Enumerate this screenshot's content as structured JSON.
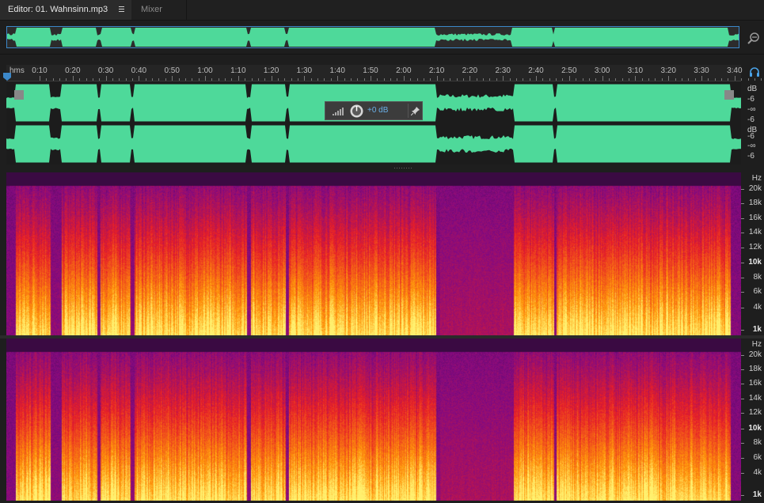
{
  "tabs": {
    "editor_label": "Editor: 01. Wahnsinn.mp3",
    "mixer_label": "Mixer"
  },
  "icons": [
    "panel-menu-icon",
    "zoom-icon",
    "playhead-icon",
    "headphone-icon",
    "hud-meter-icon",
    "gain-knob-icon",
    "pin-icon",
    "scroll-handle-icon"
  ],
  "colors": {
    "waveform": "#4ed99a",
    "selection_border": "#3c88c9",
    "accent_blue": "#6ab0e8",
    "background": "#1e1e1e"
  },
  "ruler": {
    "unit": "hms",
    "ticks": [
      "0:10",
      "0:20",
      "0:30",
      "0:40",
      "0:50",
      "1:00",
      "1:10",
      "1:20",
      "1:30",
      "1:40",
      "1:50",
      "2:00",
      "2:10",
      "2:20",
      "2:30",
      "2:40",
      "2:50",
      "3:00",
      "3:10",
      "3:20",
      "3:30",
      "3:40"
    ]
  },
  "amplitude_scale": {
    "ch1": [
      "dB",
      "-6",
      "-∞",
      "-6"
    ],
    "ch2": [
      "dB",
      "-6",
      "-∞",
      "-6"
    ]
  },
  "hud": {
    "gain": "+0 dB"
  },
  "frequency_scale": {
    "unit": "Hz",
    "labels": [
      "20k",
      "18k",
      "16k",
      "14k",
      "12k",
      "10k",
      "8k",
      "6k",
      "4k",
      "1k"
    ]
  }
}
